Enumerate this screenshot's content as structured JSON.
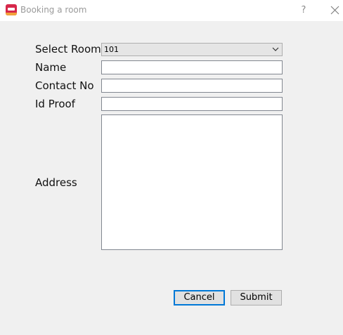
{
  "window": {
    "title": "Booking a room",
    "help_glyph": "?"
  },
  "icons": {
    "app": "hotel-bed-icon",
    "help": "question-mark-icon",
    "close": "close-icon",
    "dropdown": "chevron-down-icon"
  },
  "form": {
    "room_label": "Select Room",
    "room_value": "101",
    "name_label": "Name",
    "name_value": "",
    "contact_label": "Contact No",
    "contact_value": "",
    "idproof_label": "Id Proof",
    "idproof_value": "",
    "address_label": "Address",
    "address_value": ""
  },
  "buttons": {
    "cancel": "Cancel",
    "submit": "Submit"
  },
  "colors": {
    "background": "#f0f0f0",
    "focus_accent": "#0078d7",
    "app_icon": "#d6284a"
  }
}
